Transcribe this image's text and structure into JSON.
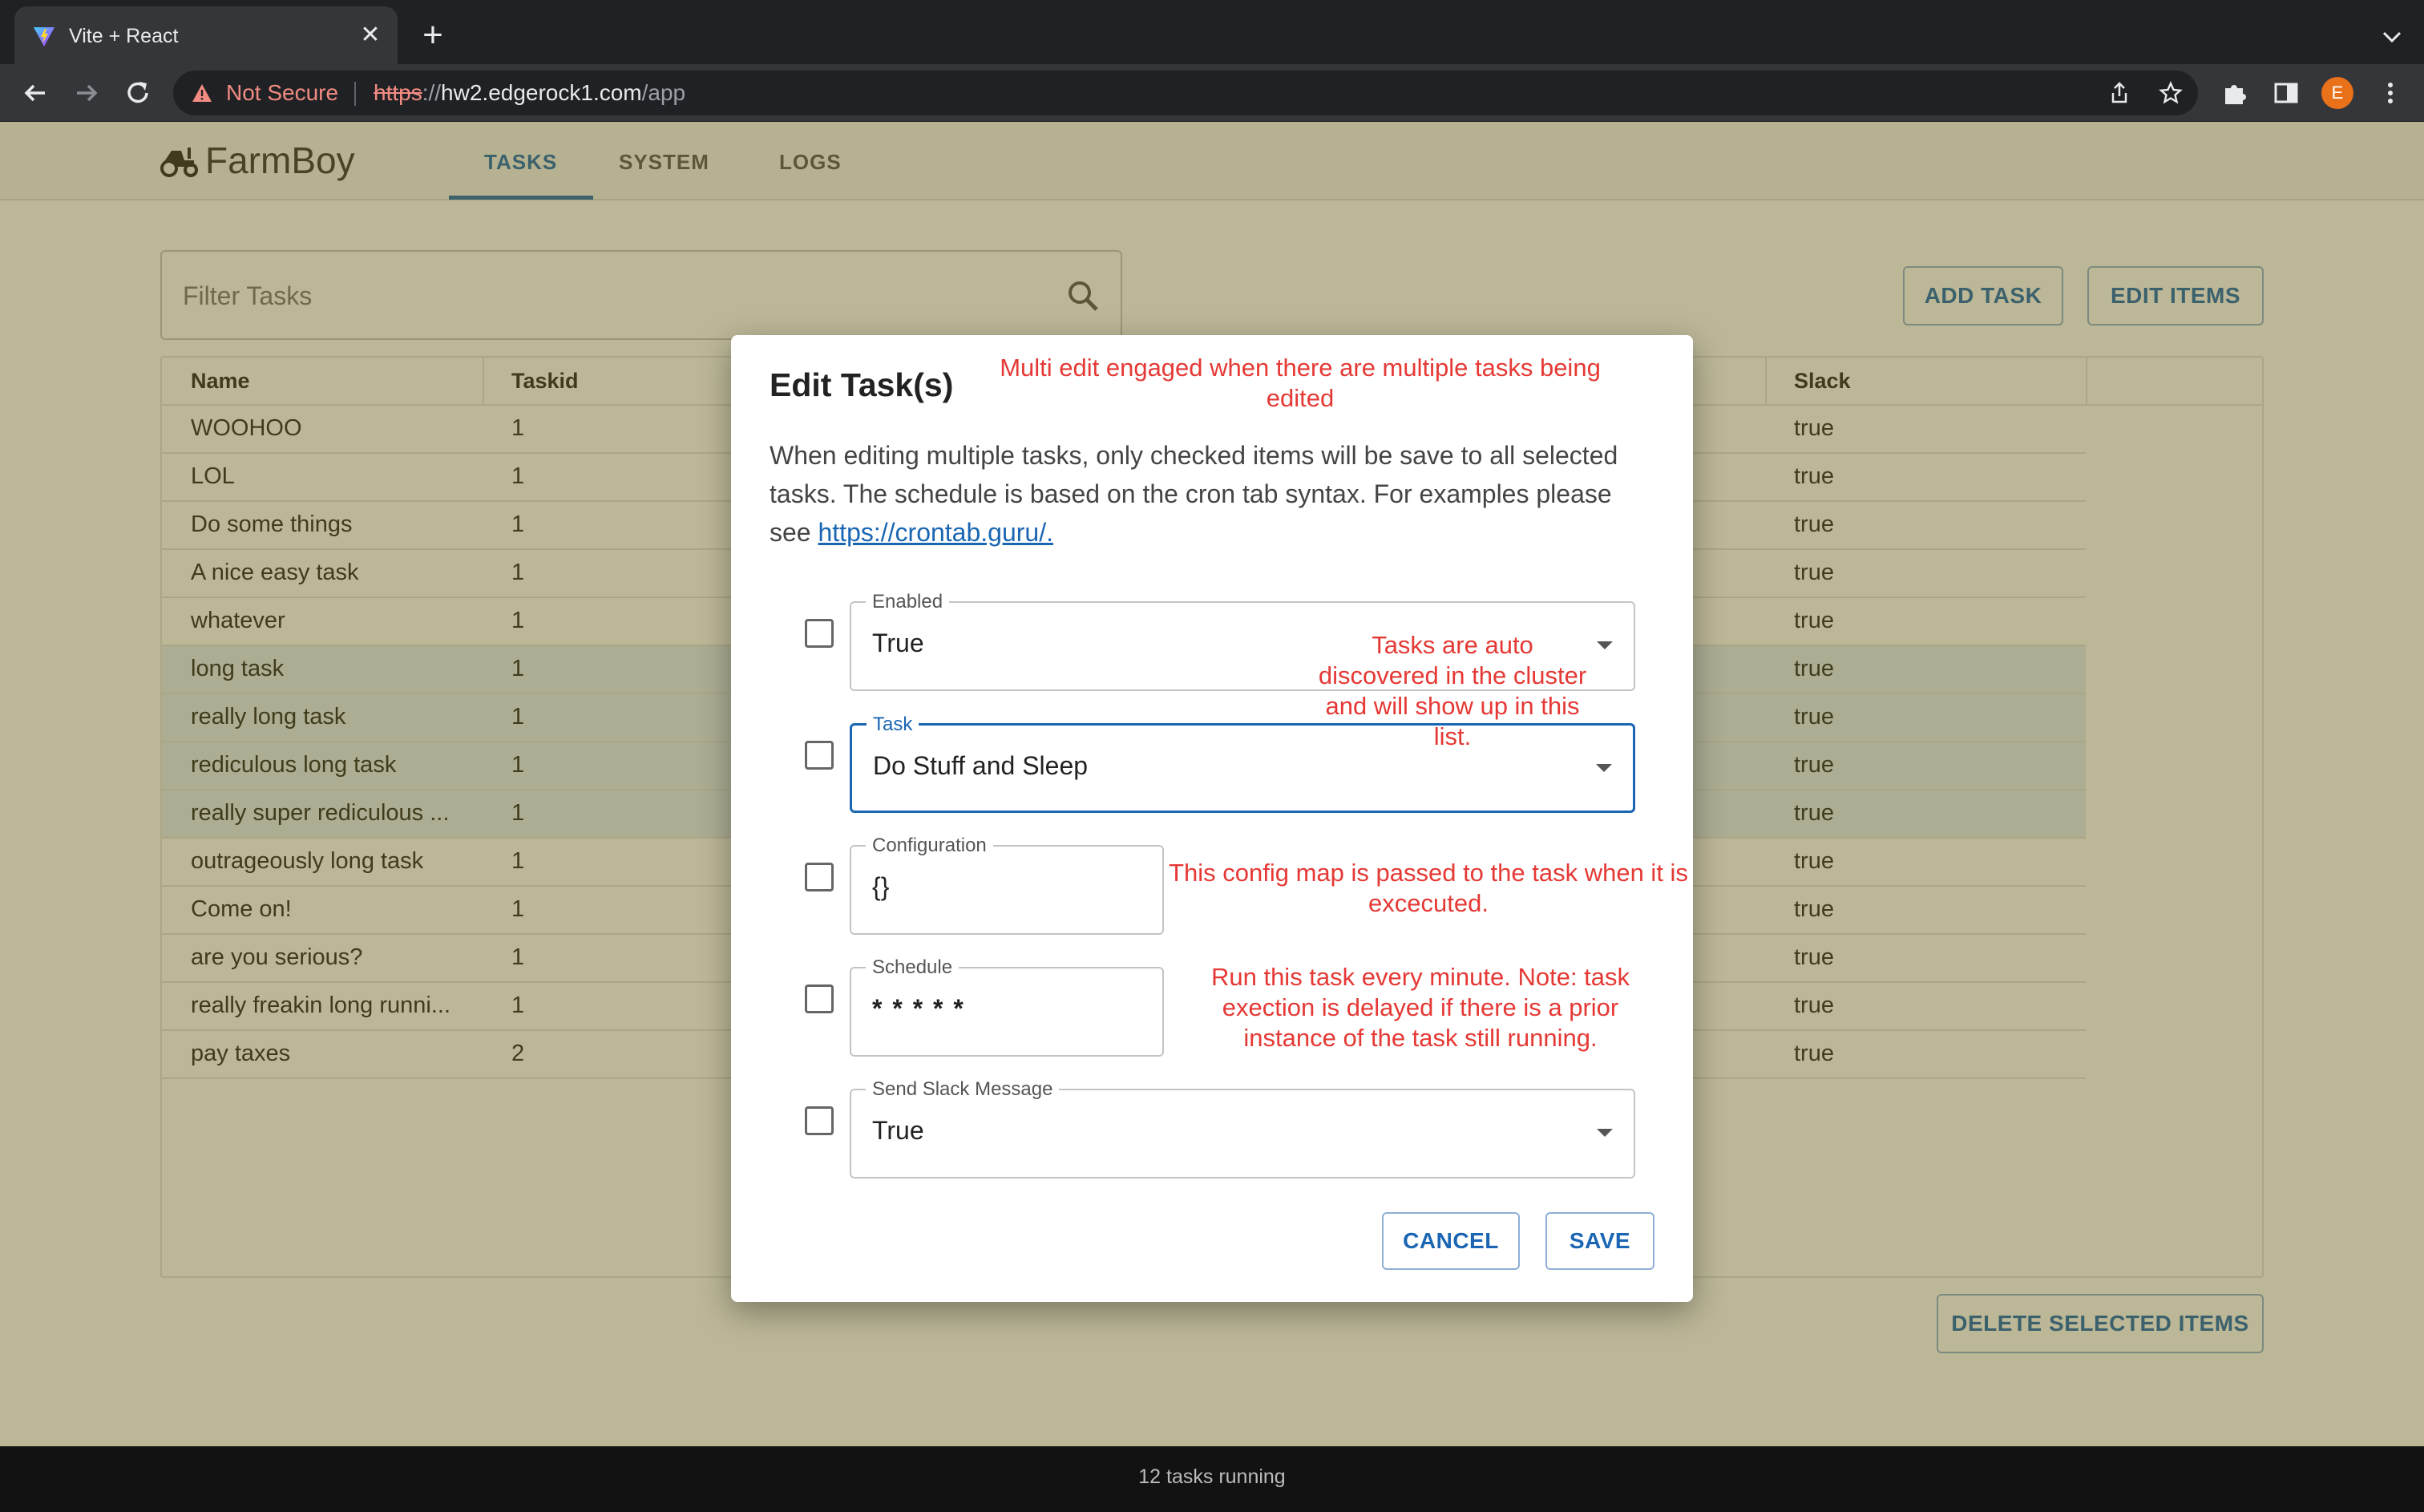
{
  "browser": {
    "tab_title": "Vite + React",
    "security_label": "Not Secure",
    "url_scheme": "https",
    "url_sep": "://",
    "url_host": "hw2.edgerock1.com",
    "url_path": "/app",
    "profile_initial": "E"
  },
  "app": {
    "logo_text": "FarmBoy",
    "nav_tabs": [
      "TASKS",
      "SYSTEM",
      "LOGS"
    ],
    "active_tab": "TASKS",
    "filter_placeholder": "Filter Tasks",
    "add_task_label": "ADD TASK",
    "edit_items_label": "EDIT ITEMS",
    "delete_selected_label": "DELETE SELECTED ITEMS",
    "footer_status": "12 tasks running",
    "accent_color": "#1a66b3"
  },
  "table": {
    "headers": {
      "name": "Name",
      "taskid": "Taskid",
      "slack": "Slack"
    },
    "rows": [
      {
        "name": "WOOHOO",
        "taskid": "1",
        "slack": "true",
        "selected": false
      },
      {
        "name": "LOL",
        "taskid": "1",
        "slack": "true",
        "selected": false
      },
      {
        "name": "Do some things",
        "taskid": "1",
        "slack": "true",
        "selected": false
      },
      {
        "name": "A nice easy task",
        "taskid": "1",
        "slack": "true",
        "selected": false
      },
      {
        "name": "whatever",
        "taskid": "1",
        "slack": "true",
        "selected": false
      },
      {
        "name": "long task",
        "taskid": "1",
        "slack": "true",
        "selected": true
      },
      {
        "name": "really long task",
        "taskid": "1",
        "slack": "true",
        "selected": true
      },
      {
        "name": "rediculous long task",
        "taskid": "1",
        "slack": "true",
        "selected": true
      },
      {
        "name": "really super rediculous ...",
        "taskid": "1",
        "slack": "true",
        "selected": true
      },
      {
        "name": "outrageously long task",
        "taskid": "1",
        "slack": "true",
        "selected": false
      },
      {
        "name": "Come on!",
        "taskid": "1",
        "slack": "true",
        "selected": false
      },
      {
        "name": "are you serious?",
        "taskid": "1",
        "slack": "true",
        "selected": false
      },
      {
        "name": "really freakin long runni...",
        "taskid": "1",
        "slack": "true",
        "selected": false
      },
      {
        "name": "pay taxes",
        "taskid": "2",
        "slack": "true",
        "selected": false
      }
    ]
  },
  "dialog": {
    "title": "Edit Task(s)",
    "desc_text": "When editing multiple tasks, only checked items will be save to all selected tasks. The schedule is based on the cron tab syntax. For examples please see",
    "desc_link": "https://crontab.guru/.",
    "fields": {
      "enabled": {
        "label": "Enabled",
        "value": "True"
      },
      "task": {
        "label": "Task",
        "value": "Do Stuff and Sleep"
      },
      "configuration": {
        "label": "Configuration",
        "value": "{}"
      },
      "schedule": {
        "label": "Schedule",
        "value": "* * * * *"
      },
      "slack": {
        "label": "Send Slack Message",
        "value": "True"
      }
    },
    "cancel_label": "CANCEL",
    "save_label": "SAVE"
  },
  "annotations": {
    "multi_edit": "Multi edit engaged when there are multiple tasks being edited",
    "task_discovery": "Tasks are auto discovered in the cluster and will show up in this list.",
    "config_map": "This config map is passed to the task when it is excecuted.",
    "schedule": "Run this task every minute. Note: task exection is delayed if there is a prior instance of the task still running."
  }
}
